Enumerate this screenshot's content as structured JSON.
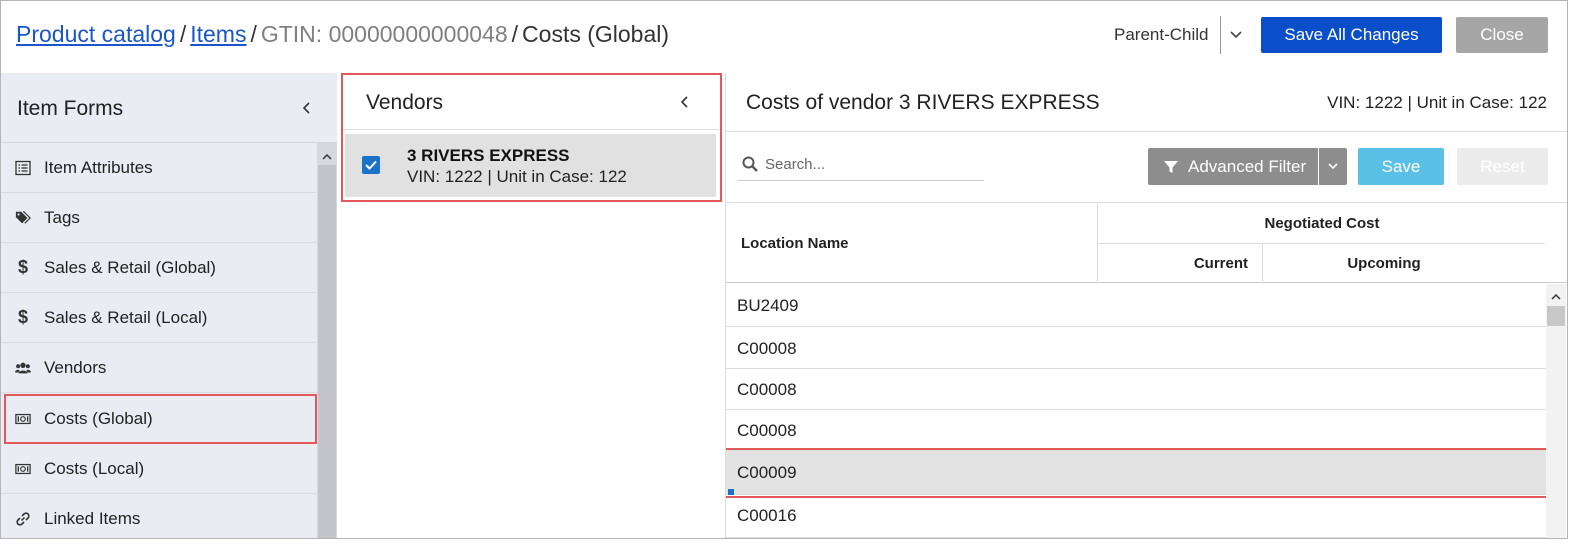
{
  "header": {
    "breadcrumb": {
      "catalog": "Product catalog",
      "items": "Items",
      "gtin": "GTIN: 00000000000048",
      "current": "Costs (Global)",
      "separator": "/"
    },
    "mode_label": "Parent-Child",
    "save_all_label": "Save All Changes",
    "close_label": "Close"
  },
  "sidebar": {
    "title": "Item Forms",
    "items": [
      {
        "label": "Item Attributes",
        "icon": "list-icon"
      },
      {
        "label": "Tags",
        "icon": "tags-icon"
      },
      {
        "label": "Sales & Retail (Global)",
        "icon": "dollar-icon"
      },
      {
        "label": "Sales & Retail (Local)",
        "icon": "dollar-icon"
      },
      {
        "label": "Vendors",
        "icon": "users-icon"
      },
      {
        "label": "Costs (Global)",
        "icon": "money-icon",
        "selected": true
      },
      {
        "label": "Costs (Local)",
        "icon": "money-icon"
      },
      {
        "label": "Linked Items",
        "icon": "link-icon"
      }
    ]
  },
  "vendors": {
    "title": "Vendors",
    "selected_vendor": {
      "name": "3 RIVERS EXPRESS",
      "details": "VIN: 1222 | Unit in Case: 122",
      "checked": true
    }
  },
  "costs": {
    "title": "Costs of vendor 3 RIVERS EXPRESS",
    "meta": "VIN: 1222 | Unit in Case: 122",
    "search": {
      "placeholder": "Search...",
      "value": ""
    },
    "advanced_filter_label": "Advanced Filter",
    "save_label": "Save",
    "reset_label": "Reset",
    "table": {
      "col_location": "Location Name",
      "col_group": "Negotiated Cost",
      "col_current": "Current",
      "col_upcoming": "Upcoming",
      "rows": [
        {
          "location": "BU2409",
          "current": "",
          "upcoming": ""
        },
        {
          "location": "C00008",
          "current": "",
          "upcoming": ""
        },
        {
          "location": "C00008",
          "current": "",
          "upcoming": ""
        },
        {
          "location": "C00008",
          "current": "",
          "upcoming": ""
        },
        {
          "location": "C00009",
          "current": "",
          "upcoming": "",
          "selected": true
        },
        {
          "location": "C00016",
          "current": "",
          "upcoming": ""
        }
      ]
    }
  },
  "colors": {
    "primary_blue": "#0a4fc9",
    "link_blue": "#1a56c7",
    "highlight_red": "#e05a5a",
    "save_cyan": "#5bc0e6",
    "sidebar_bg": "#e9ecf2"
  }
}
